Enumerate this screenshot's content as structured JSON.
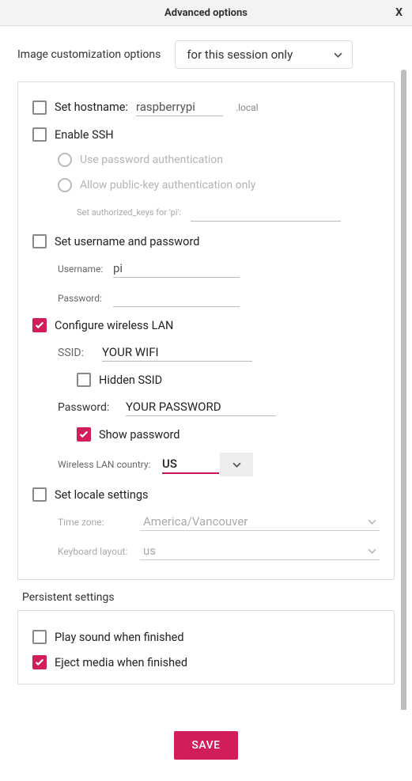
{
  "header": {
    "title": "Advanced options",
    "close": "X"
  },
  "top": {
    "label": "Image customization options",
    "session_value": "for this session only"
  },
  "hostname": {
    "checked": false,
    "label": "Set hostname:",
    "value": "raspberrypi",
    "suffix": ".local"
  },
  "ssh": {
    "checked": false,
    "label": "Enable SSH",
    "radio_password": "Use password authentication",
    "radio_pubkey": "Allow public-key authentication only",
    "authkeys_label": "Set authorized_keys for 'pi':",
    "authkeys_value": ""
  },
  "userpass": {
    "checked": false,
    "label": "Set username and password",
    "username_label": "Username:",
    "username_value": "pi",
    "password_label": "Password:",
    "password_value": ""
  },
  "wifi": {
    "checked": true,
    "label": "Configure wireless LAN",
    "ssid_label": "SSID:",
    "ssid_value": "YOUR WIFI",
    "hidden_checked": false,
    "hidden_label": "Hidden SSID",
    "password_label": "Password:",
    "password_value": "YOUR PASSWORD",
    "showpw_checked": true,
    "showpw_label": "Show password",
    "country_label": "Wireless LAN country:",
    "country_value": "US"
  },
  "locale": {
    "checked": false,
    "label": "Set locale settings",
    "tz_label": "Time zone:",
    "tz_value": "America/Vancouver",
    "kb_label": "Keyboard layout:",
    "kb_value": "us"
  },
  "persistent": {
    "header": "Persistent settings",
    "sound_checked": false,
    "sound_label": "Play sound when finished",
    "eject_checked": true,
    "eject_label": "Eject media when finished"
  },
  "footer": {
    "save": "SAVE"
  },
  "colors": {
    "accent": "#d11e5a"
  }
}
